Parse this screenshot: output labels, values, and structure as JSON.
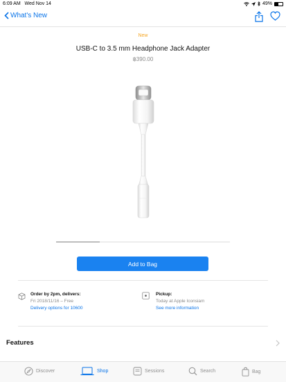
{
  "status": {
    "time": "6:09 AM",
    "date": "Wed Nov 14",
    "battery": "49%",
    "battery_level": 0.49
  },
  "nav": {
    "back_label": "What's New",
    "share_icon": "share-icon",
    "favorite_icon": "heart-icon"
  },
  "product": {
    "badge": "New",
    "title": "USB-C to 3.5 mm Headphone Jack Adapter",
    "price": "฿390.00"
  },
  "gallery": {
    "scroll_position": 0.25
  },
  "actions": {
    "add_to_bag": "Add to Bag"
  },
  "delivery": {
    "heading": "Order by 2pm, delivers:",
    "date": "Fri 2018/11/16 – Free",
    "link": "Delivery options for 10600"
  },
  "pickup": {
    "heading": "Pickup:",
    "detail": "Today at Apple Iconsiam",
    "link": "See more information"
  },
  "features": {
    "label": "Features"
  },
  "tabs": [
    {
      "label": "Discover",
      "icon": "compass-icon",
      "active": false
    },
    {
      "label": "Shop",
      "icon": "laptop-icon",
      "active": true
    },
    {
      "label": "Sessions",
      "icon": "sessions-icon",
      "active": false
    },
    {
      "label": "Search",
      "icon": "search-icon",
      "active": false
    },
    {
      "label": "Bag",
      "icon": "bag-icon",
      "active": false
    }
  ],
  "colors": {
    "accent": "#0a74e8",
    "button": "#1a82f0",
    "badge": "#f5a623"
  }
}
